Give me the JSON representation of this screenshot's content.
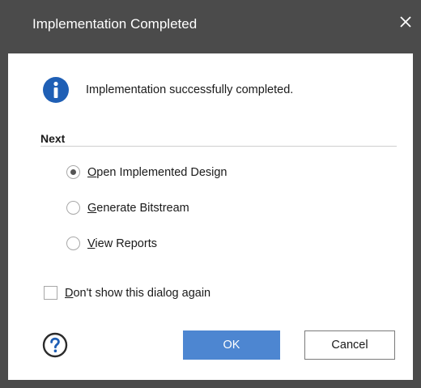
{
  "window": {
    "title": "Implementation Completed",
    "close_icon": "close-icon"
  },
  "message": {
    "icon": "info-icon",
    "text": "Implementation successfully completed."
  },
  "next": {
    "title": "Next",
    "options": [
      {
        "mnemonic": "O",
        "rest": "pen Implemented Design",
        "selected": true
      },
      {
        "mnemonic": "G",
        "rest": "enerate Bitstream",
        "selected": false
      },
      {
        "mnemonic": "V",
        "rest": "iew Reports",
        "selected": false
      }
    ]
  },
  "dont_show": {
    "mnemonic": "D",
    "rest": "on't show this dialog again",
    "checked": false
  },
  "buttons": {
    "help_icon": "help-icon",
    "ok_label": "OK",
    "cancel_label": "Cancel"
  },
  "colors": {
    "titlebar": "#4b4b4b",
    "accent": "#4d86d1",
    "info_icon": "#1f5fb5"
  }
}
